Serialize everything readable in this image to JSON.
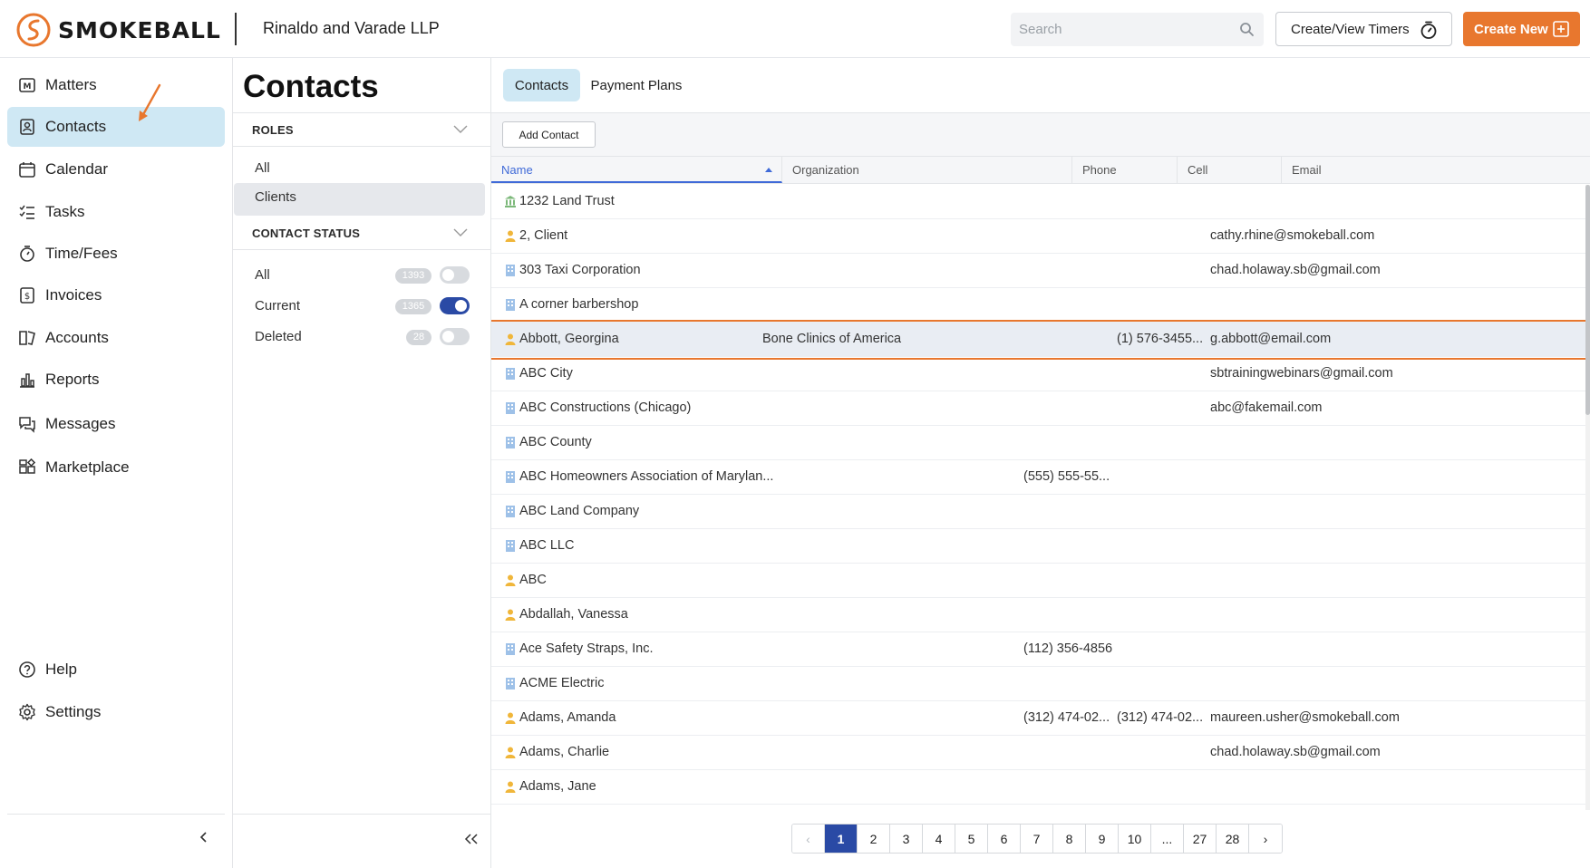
{
  "header": {
    "logo_text": "SMOKEBALL",
    "firm_name": "Rinaldo and Varade LLP",
    "search_placeholder": "Search",
    "timers_label": "Create/View Timers",
    "create_new_label": "Create New",
    "accent_color": "#e8772e"
  },
  "sidebar": {
    "items": [
      {
        "label": "Matters",
        "icon": "matters-icon"
      },
      {
        "label": "Contacts",
        "icon": "contacts-icon",
        "active": true
      },
      {
        "label": "Calendar",
        "icon": "calendar-icon"
      },
      {
        "label": "Tasks",
        "icon": "tasks-icon"
      },
      {
        "label": "Time/Fees",
        "icon": "stopwatch-icon"
      },
      {
        "label": "Invoices",
        "icon": "invoice-icon"
      },
      {
        "label": "Accounts",
        "icon": "accounts-icon"
      },
      {
        "label": "Reports",
        "icon": "reports-icon"
      },
      {
        "label": "Messages",
        "icon": "messages-icon"
      },
      {
        "label": "Marketplace",
        "icon": "marketplace-icon"
      }
    ],
    "bottom_items": [
      {
        "label": "Help",
        "icon": "help-icon"
      },
      {
        "label": "Settings",
        "icon": "settings-icon"
      }
    ]
  },
  "filters": {
    "page_title": "Contacts",
    "roles_title": "ROLES",
    "roles": [
      "All",
      "Clients"
    ],
    "selected_role": "Clients",
    "status_title": "CONTACT STATUS",
    "statuses": [
      {
        "label": "All",
        "count": "1393",
        "on": false
      },
      {
        "label": "Current",
        "count": "1365",
        "on": true
      },
      {
        "label": "Deleted",
        "count": "28",
        "on": false
      }
    ]
  },
  "main": {
    "tabs": [
      {
        "label": "Contacts",
        "active": true
      },
      {
        "label": "Payment Plans",
        "active": false
      }
    ],
    "add_contact_label": "Add Contact",
    "columns": [
      "Name",
      "Organization",
      "Phone",
      "Cell",
      "Email"
    ],
    "rows": [
      {
        "type": "trust",
        "name": "1232 Land Trust",
        "org": "",
        "phone": "",
        "cell": "",
        "email": ""
      },
      {
        "type": "person",
        "name": "2, Client",
        "org": "",
        "phone": "",
        "cell": "",
        "email": "cathy.rhine@smokeball.com"
      },
      {
        "type": "company",
        "name": "303 Taxi Corporation",
        "org": "",
        "phone": "",
        "cell": "",
        "email": "chad.holaway.sb@gmail.com"
      },
      {
        "type": "company",
        "name": "A corner barbershop",
        "org": "",
        "phone": "",
        "cell": "",
        "email": ""
      },
      {
        "type": "person",
        "name": "Abbott, Georgina",
        "org": "Bone Clinics of America",
        "phone": "",
        "cell": "(1) 576-3455...",
        "email": "g.abbott@email.com",
        "highlight": true
      },
      {
        "type": "company",
        "name": "ABC City",
        "org": "",
        "phone": "",
        "cell": "",
        "email": "sbtrainingwebinars@gmail.com"
      },
      {
        "type": "company",
        "name": "ABC Constructions (Chicago)",
        "org": "",
        "phone": "",
        "cell": "",
        "email": "abc@fakemail.com"
      },
      {
        "type": "company",
        "name": "ABC County",
        "org": "",
        "phone": "",
        "cell": "",
        "email": ""
      },
      {
        "type": "company",
        "name": "ABC Homeowners Association of Marylan...",
        "org": "",
        "phone": "(555) 555-55...",
        "cell": "",
        "email": ""
      },
      {
        "type": "company",
        "name": "ABC Land Company",
        "org": "",
        "phone": "",
        "cell": "",
        "email": ""
      },
      {
        "type": "company",
        "name": "ABC LLC",
        "org": "",
        "phone": "",
        "cell": "",
        "email": ""
      },
      {
        "type": "person",
        "name": "ABC",
        "org": "",
        "phone": "",
        "cell": "",
        "email": ""
      },
      {
        "type": "person",
        "name": "Abdallah, Vanessa",
        "org": "",
        "phone": "",
        "cell": "",
        "email": ""
      },
      {
        "type": "company",
        "name": "Ace Safety Straps, Inc.",
        "org": "",
        "phone": "(112) 356-4856",
        "cell": "",
        "email": ""
      },
      {
        "type": "company",
        "name": "ACME Electric",
        "org": "",
        "phone": "",
        "cell": "",
        "email": ""
      },
      {
        "type": "person",
        "name": "Adams, Amanda",
        "org": "",
        "phone": "(312) 474-02...",
        "cell": "(312) 474-02...",
        "email": "maureen.usher@smokeball.com"
      },
      {
        "type": "person",
        "name": "Adams, Charlie",
        "org": "",
        "phone": "",
        "cell": "",
        "email": "chad.holaway.sb@gmail.com"
      },
      {
        "type": "person",
        "name": "Adams, Jane",
        "org": "",
        "phone": "",
        "cell": "",
        "email": ""
      }
    ],
    "pagination": {
      "prev": "‹",
      "pages": [
        "1",
        "2",
        "3",
        "4",
        "5",
        "6",
        "7",
        "8",
        "9",
        "10",
        "...",
        "27",
        "28"
      ],
      "current": "1",
      "next": "›"
    }
  }
}
